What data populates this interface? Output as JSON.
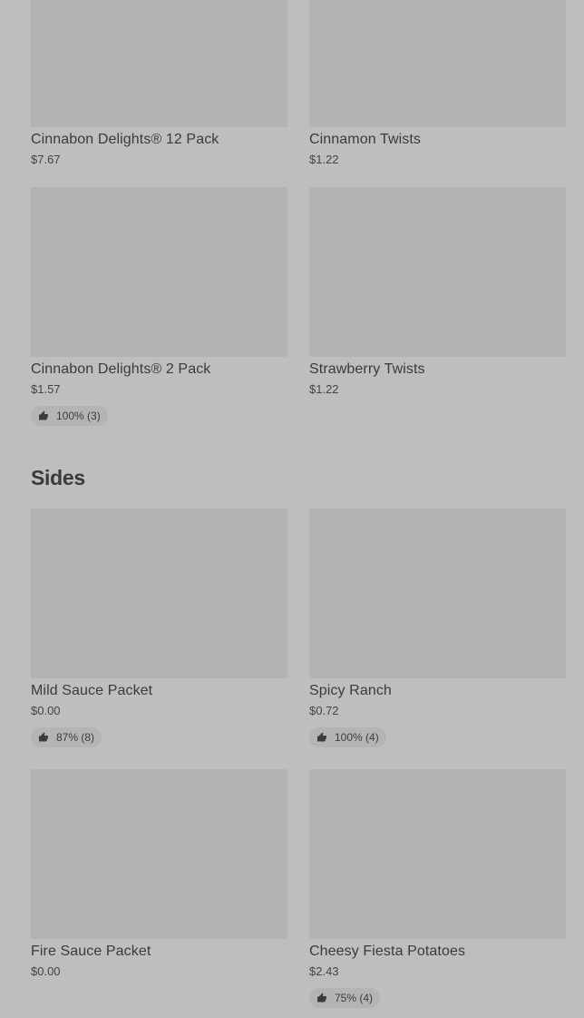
{
  "sweets": {
    "items": [
      {
        "name": "Cinnabon Delights® 12 Pack",
        "price": "$7.67"
      },
      {
        "name": "Cinnamon Twists",
        "price": "$1.22"
      },
      {
        "name": "Cinnabon Delights® 2 Pack",
        "price": "$1.57",
        "rating": "100% (3)"
      },
      {
        "name": "Strawberry Twists",
        "price": "$1.22"
      }
    ]
  },
  "sides": {
    "title": "Sides",
    "items": [
      {
        "name": "Mild Sauce Packet",
        "price": "$0.00",
        "rating": "87% (8)"
      },
      {
        "name": "Spicy Ranch",
        "price": "$0.72",
        "rating": "100% (4)"
      },
      {
        "name": "Fire Sauce Packet",
        "price": "$0.00"
      },
      {
        "name": "Cheesy Fiesta Potatoes",
        "price": "$2.43",
        "rating": "75% (4)"
      }
    ]
  },
  "icons": {
    "rating": "thumbs-up-icon"
  }
}
